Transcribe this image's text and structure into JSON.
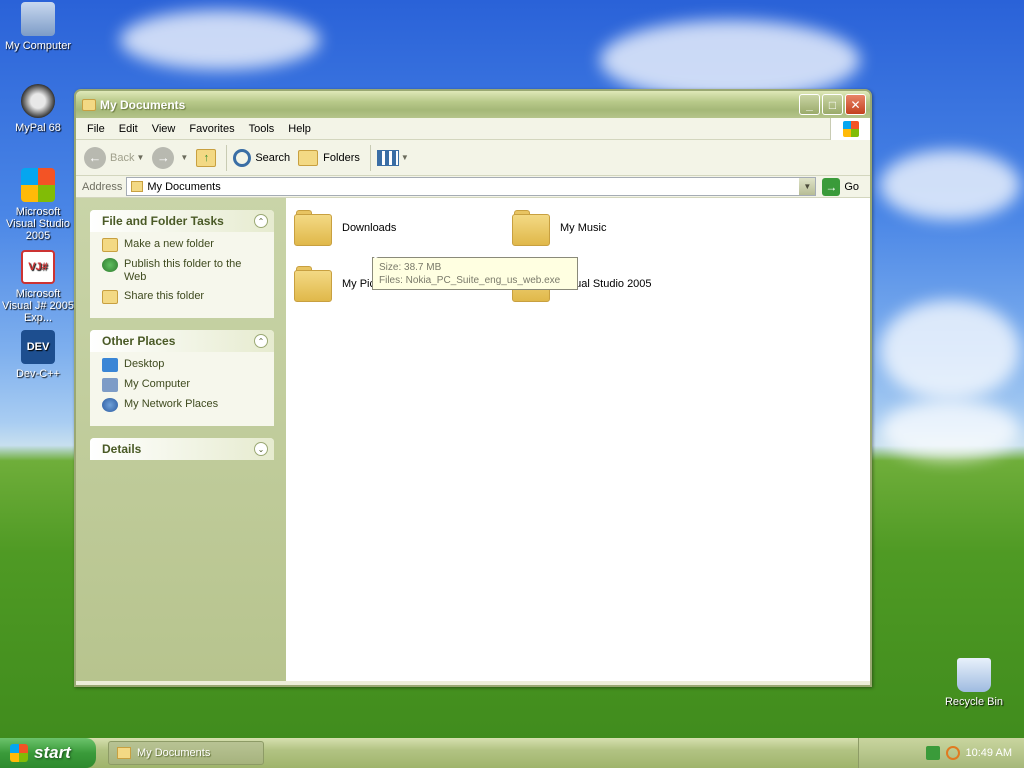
{
  "desktop": {
    "icons": [
      {
        "label": "My Computer"
      },
      {
        "label": "MyPal 68"
      },
      {
        "label": "Microsoft Visual Studio 2005"
      },
      {
        "label": "Microsoft Visual J# 2005 Exp..."
      },
      {
        "label": "Dev-C++"
      },
      {
        "label": "Recycle Bin"
      }
    ]
  },
  "window": {
    "title": "My Documents",
    "menu": [
      "File",
      "Edit",
      "View",
      "Favorites",
      "Tools",
      "Help"
    ],
    "toolbar": {
      "back": "Back",
      "search": "Search",
      "folders": "Folders"
    },
    "address": {
      "label": "Address",
      "value": "My Documents",
      "go": "Go"
    },
    "sidebar": {
      "file_tasks": {
        "title": "File and Folder Tasks",
        "items": [
          "Make a new folder",
          "Publish this folder to the Web",
          "Share this folder"
        ]
      },
      "other_places": {
        "title": "Other Places",
        "items": [
          "Desktop",
          "My Computer",
          "My Network Places"
        ]
      },
      "details": {
        "title": "Details"
      }
    },
    "folders": [
      {
        "name": "Downloads"
      },
      {
        "name": "My Music"
      },
      {
        "name": "My Pictures"
      },
      {
        "name": "Visual Studio 2005"
      }
    ],
    "tooltip": {
      "size": "Size: 38.7 MB",
      "files": "Files: Nokia_PC_Suite_eng_us_web.exe"
    }
  },
  "taskbar": {
    "start": "start",
    "task": "My Documents",
    "clock": "10:49 AM"
  }
}
